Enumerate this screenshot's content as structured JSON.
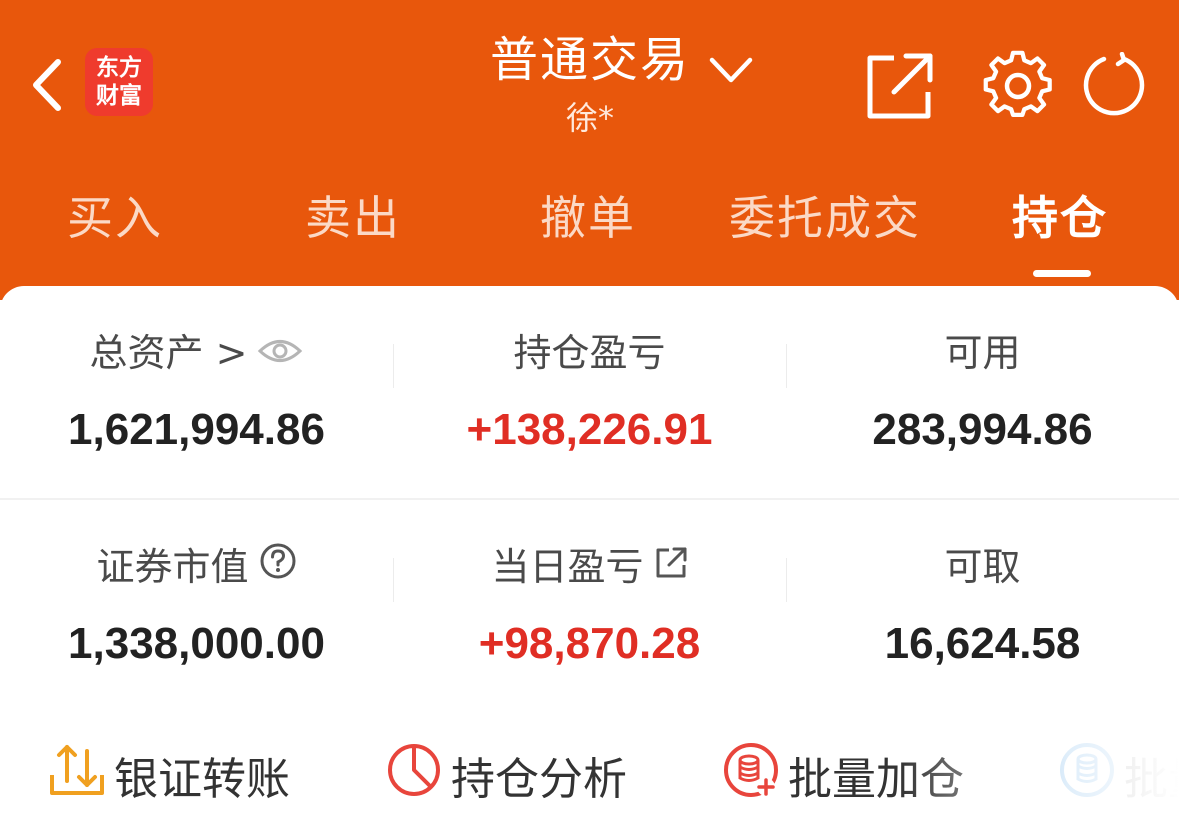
{
  "header": {
    "logo_line1": "东方",
    "logo_line2": "财富",
    "title": "普通交易",
    "subtitle": "徐*"
  },
  "tabs": [
    {
      "label": "买入",
      "active": false
    },
    {
      "label": "卖出",
      "active": false
    },
    {
      "label": "撤单",
      "active": false
    },
    {
      "label": "委托成交",
      "active": false
    },
    {
      "label": "持仓",
      "active": true
    }
  ],
  "summary": {
    "total_assets_label": "总资产 >",
    "total_assets_value": "1,621,994.86",
    "position_pl_label": "持仓盈亏",
    "position_pl_value": "+138,226.91",
    "available_label": "可用",
    "available_value": "283,994.86",
    "market_value_label": "证券市值",
    "market_value_value": "1,338,000.00",
    "daily_pl_label": "当日盈亏",
    "daily_pl_value": "+98,870.28",
    "withdrawable_label": "可取",
    "withdrawable_value": "16,624.58"
  },
  "actions": [
    {
      "label": "银证转账",
      "icon": "transfer-icon"
    },
    {
      "label": "持仓分析",
      "icon": "pie-chart-icon"
    },
    {
      "label": "批量加仓",
      "icon": "database-plus-icon"
    },
    {
      "label": "批量",
      "icon": "database-icon"
    }
  ],
  "colors": {
    "brand_orange": "#e8570c",
    "logo_red": "#ef3b2d",
    "profit_red": "#e02e24",
    "action_orange": "#f0a020",
    "action_red": "#e8453c",
    "action_blue": "#2f8fe0"
  }
}
